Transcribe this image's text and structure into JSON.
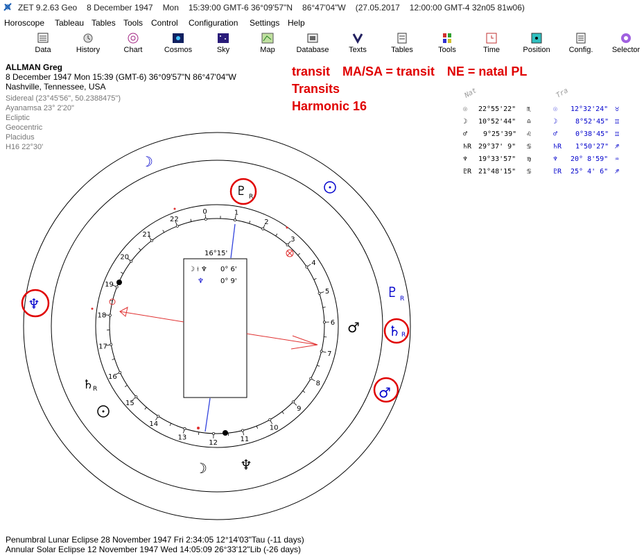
{
  "window": {
    "title_parts": [
      "ZET 9.2.63 Geo",
      "8 December 1947",
      "Mon",
      "15:39:00 GMT-6 36°09'57\"N",
      "86°47'04\"W",
      "(27.05.2017",
      "12:00:00 GMT-4 32n05 81w06)"
    ]
  },
  "menu": [
    "Horoscope",
    "Tableau",
    "Tables",
    "Tools",
    "Control",
    "Configuration",
    "Settings",
    "Help"
  ],
  "toolbar": [
    {
      "label": "Data",
      "icon": "data-icon"
    },
    {
      "label": "History",
      "icon": "history-icon"
    },
    {
      "label": "Chart",
      "icon": "chart-icon"
    },
    {
      "label": "Cosmos",
      "icon": "cosmos-icon"
    },
    {
      "label": "Sky",
      "icon": "sky-icon"
    },
    {
      "label": "Map",
      "icon": "map-icon"
    },
    {
      "label": "Database",
      "icon": "database-icon"
    },
    {
      "label": "Texts",
      "icon": "texts-icon"
    },
    {
      "label": "Tables",
      "icon": "tables-icon"
    },
    {
      "label": "Tools",
      "icon": "tools-icon"
    },
    {
      "label": "Time",
      "icon": "time-icon"
    },
    {
      "label": "Position",
      "icon": "position-icon"
    },
    {
      "label": "Config.",
      "icon": "config-icon"
    },
    {
      "label": "Selector",
      "icon": "selector-icon"
    }
  ],
  "person": {
    "name": "ALLMAN Greg",
    "datetime": "8 December 1947  Mon  15:39 (GMT-6) 36°09'57\"N  86°47'04\"W",
    "place": "Nashville, Tennessee, USA",
    "settings": [
      "Sidereal (23°45'56\", 50.2388475\")",
      "Ayanamsa 23° 2'20\"",
      "Ecliptic",
      "Geocentric",
      "Placidus",
      "H16  22°30'"
    ]
  },
  "headline": {
    "line1": [
      "transit",
      "MA/SA = transit",
      "NE = natal PL"
    ],
    "line2": "Transits",
    "line3": "Harmonic 16"
  },
  "planet_table": {
    "header_natal": "Nat",
    "header_transit": "Tra",
    "rows": [
      {
        "glyph": "☉",
        "natal": "22°55'22\"",
        "natal_sign": "♏",
        "t_glyph": "☉",
        "transit": "12°32'24\"",
        "transit_sign": "♉"
      },
      {
        "glyph": "☽",
        "natal": "10°52'44\"",
        "natal_sign": "♎",
        "t_glyph": "☽",
        "transit": "8°52'45\"",
        "transit_sign": "♊"
      },
      {
        "glyph": "♂",
        "natal": "9°25'39\"",
        "natal_sign": "♌",
        "t_glyph": "♂",
        "transit": "0°38'45\"",
        "transit_sign": "♊"
      },
      {
        "glyph": "♄R",
        "natal": "29°37' 9\"",
        "natal_sign": "♋",
        "t_glyph": "♄R",
        "transit": "1°50'27\"",
        "transit_sign": "♐"
      },
      {
        "glyph": "♆",
        "natal": "19°33'57\"",
        "natal_sign": "♍",
        "t_glyph": "♆",
        "transit": "20° 8'59\"",
        "transit_sign": "♒"
      },
      {
        "glyph": "♇R",
        "natal": "21°48'15\"",
        "natal_sign": "♋",
        "t_glyph": "♇R",
        "transit": "25° 4' 6\"",
        "transit_sign": "♐"
      }
    ]
  },
  "wheel": {
    "center_angle": "16°15'",
    "aspect_box": [
      {
        "glyphs": "☽ ⟊ ♆",
        "value": "0° 6'"
      },
      {
        "glyphs": "♆",
        "value": "0° 9'"
      }
    ],
    "degree_labels": [
      "0",
      "1",
      "2",
      "3",
      "4",
      "5",
      "6",
      "7",
      "8",
      "9",
      "10",
      "11",
      "12",
      "13",
      "14",
      "15",
      "16",
      "17",
      "18",
      "19",
      "20",
      "21",
      "22"
    ],
    "colors": {
      "natal": "#000000",
      "transit": "#0000cc",
      "highlight": "#e00000",
      "axis": "#3344dd"
    }
  },
  "footer": {
    "line1": "Penumbral Lunar Eclipse 28 November 1947 Fri  2:34:05 12°14'03\"Tau (-11 days)",
    "line2": "Annular Solar Eclipse 12 November 1947 Wed 14:05:09 26°33'12\"Lib (-26 days)"
  }
}
